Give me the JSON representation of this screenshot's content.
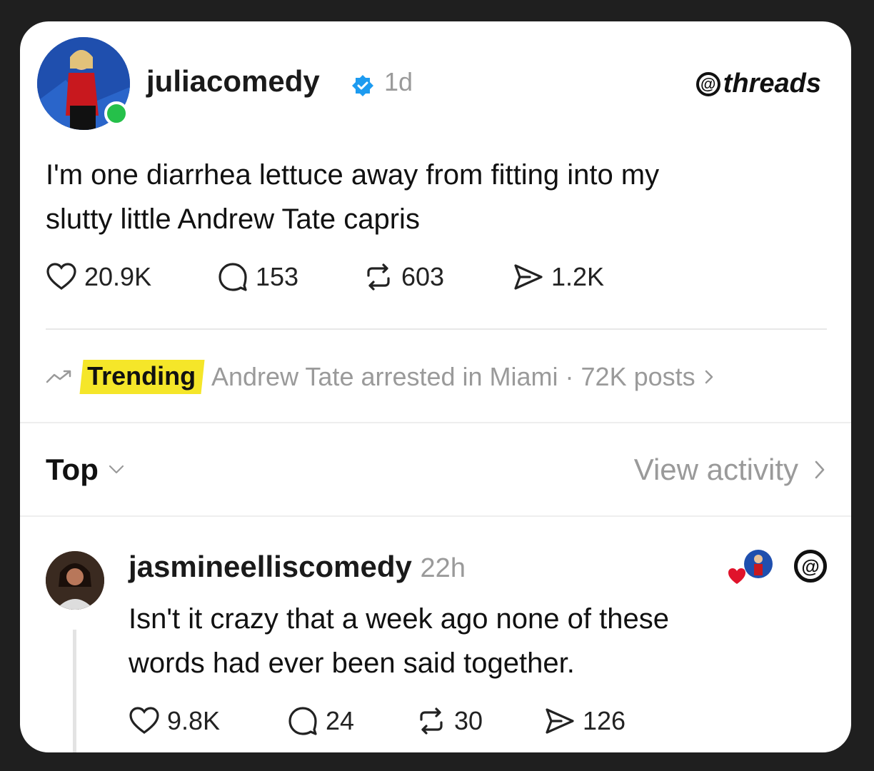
{
  "post": {
    "username": "juliacomedy",
    "time": "1d",
    "brand": "threads",
    "text_line1": "I'm one diarrhea lettuce away from fitting into my",
    "text_line2": "slutty little Andrew Tate capris",
    "likes": "20.9K",
    "replies": "153",
    "reposts": "603",
    "shares": "1.2K"
  },
  "trending": {
    "label": "Trending",
    "text": "Andrew Tate arrested in Miami · 72K posts"
  },
  "sort": {
    "label": "Top",
    "view_activity": "View activity"
  },
  "reply": {
    "username": "jasmineelliscomedy",
    "time": "22h",
    "text_line1": "Isn't it crazy that a week ago none of these",
    "text_line2": "words had ever been said together.",
    "likes": "9.8K",
    "replies": "24",
    "reposts": "30",
    "shares": "126"
  },
  "colors": {
    "verified": "#1d9bf0",
    "online": "#25c04a",
    "trend_highlight": "#f5e629",
    "muted": "#9a9a9a"
  },
  "icons": [
    "heart-icon",
    "comment-icon",
    "repost-icon",
    "share-icon",
    "verified-icon",
    "trending-icon",
    "threads-logo-icon",
    "chevron-down-icon",
    "chevron-right-icon"
  ]
}
